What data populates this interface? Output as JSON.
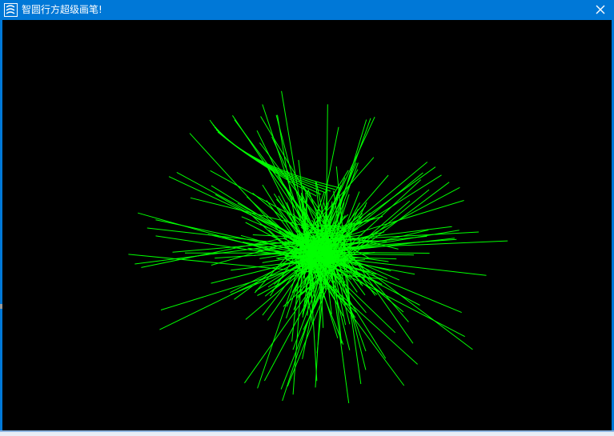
{
  "window": {
    "title": "智圆行方超级画笔!",
    "app_icon": "swirl-app-icon",
    "close_icon": "close-icon"
  },
  "colors": {
    "titlebar": "#0078d7",
    "title_text": "#ffffff",
    "canvas_background": "#000000",
    "stroke": "#00ff00"
  },
  "drawing": {
    "description_icon": "line-burst-drawing",
    "line_count": 180
  }
}
